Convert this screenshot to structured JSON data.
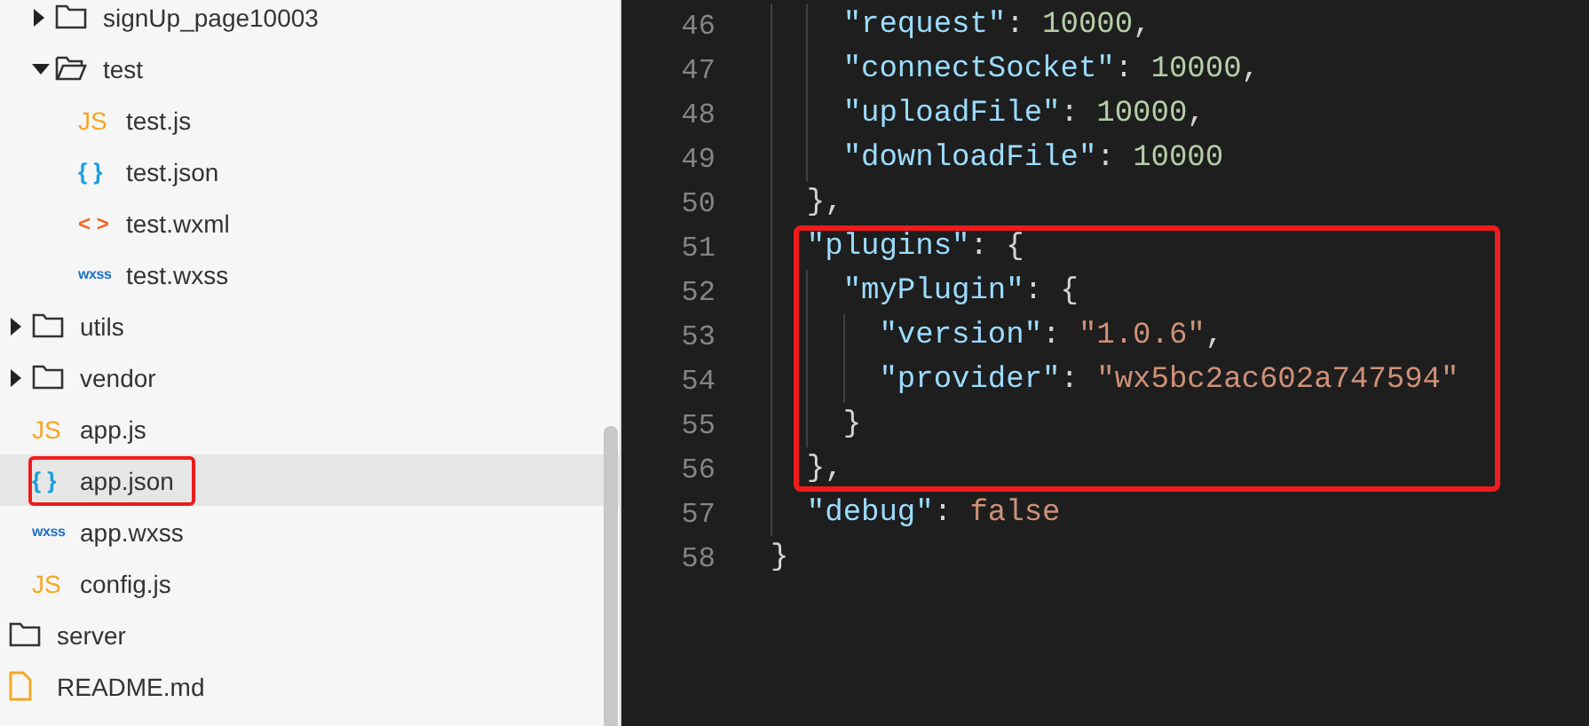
{
  "tree": [
    {
      "children": [
        {
          "children": [
            {
              "label": "signUp_page10003",
              "kind": "folder",
              "expanded": false,
              "selected": false,
              "boxed": false
            },
            {
              "label": "test",
              "kind": "folder",
              "expanded": true,
              "selected": false,
              "boxed": false,
              "children": [
                {
                  "label": "test.js",
                  "kind": "js",
                  "badge": "JS",
                  "selected": false,
                  "boxed": false
                },
                {
                  "label": "test.json",
                  "kind": "json",
                  "badge": "{ }",
                  "selected": false,
                  "boxed": false
                },
                {
                  "label": "test.wxml",
                  "kind": "wxml",
                  "badge": "< >",
                  "selected": false,
                  "boxed": false
                },
                {
                  "label": "test.wxss",
                  "kind": "wxss",
                  "badge": "wxss",
                  "selected": false,
                  "boxed": false
                }
              ]
            }
          ]
        },
        {
          "label": "utils",
          "kind": "folder",
          "expanded": false,
          "selected": false,
          "boxed": false
        },
        {
          "label": "vendor",
          "kind": "folder",
          "expanded": false,
          "selected": false,
          "boxed": false
        },
        {
          "label": "app.js",
          "kind": "js",
          "badge": "JS",
          "selected": false,
          "boxed": false
        },
        {
          "label": "app.json",
          "kind": "json",
          "badge": "{ }",
          "selected": true,
          "boxed": true
        },
        {
          "label": "app.wxss",
          "kind": "wxss",
          "badge": "wxss",
          "selected": false,
          "boxed": false
        },
        {
          "label": "config.js",
          "kind": "js",
          "badge": "JS",
          "selected": false,
          "boxed": false
        }
      ]
    },
    {
      "label": "server",
      "kind": "folder",
      "selected": false,
      "boxed": false
    },
    {
      "label": "README.md",
      "kind": "md",
      "selected": false,
      "boxed": false
    }
  ],
  "code": {
    "lines": [
      {
        "number": "46",
        "boxed": false,
        "tokens": [
          {
            "kind": "key",
            "text": "      \"request\""
          },
          {
            "kind": "punct",
            "text": ": "
          },
          {
            "kind": "num",
            "text": "10000"
          },
          {
            "kind": "punct",
            "text": ","
          }
        ]
      },
      {
        "number": "47",
        "boxed": false,
        "tokens": [
          {
            "kind": "key",
            "text": "      \"connectSocket\""
          },
          {
            "kind": "punct",
            "text": ": "
          },
          {
            "kind": "num",
            "text": "10000"
          },
          {
            "kind": "punct",
            "text": ","
          }
        ]
      },
      {
        "number": "48",
        "boxed": false,
        "tokens": [
          {
            "kind": "key",
            "text": "      \"uploadFile\""
          },
          {
            "kind": "punct",
            "text": ": "
          },
          {
            "kind": "num",
            "text": "10000"
          },
          {
            "kind": "punct",
            "text": ","
          }
        ]
      },
      {
        "number": "49",
        "boxed": false,
        "tokens": [
          {
            "kind": "key",
            "text": "      \"downloadFile\""
          },
          {
            "kind": "punct",
            "text": ": "
          },
          {
            "kind": "num",
            "text": "10000"
          }
        ]
      },
      {
        "number": "50",
        "boxed": false,
        "tokens": [
          {
            "kind": "punct",
            "text": "    },"
          }
        ]
      },
      {
        "number": "51",
        "boxed": true,
        "tokens": [
          {
            "kind": "key",
            "text": "    \"plugins\""
          },
          {
            "kind": "punct",
            "text": ": {"
          }
        ]
      },
      {
        "number": "52",
        "boxed": true,
        "tokens": [
          {
            "kind": "key",
            "text": "      \"myPlugin\""
          },
          {
            "kind": "punct",
            "text": ": {"
          }
        ]
      },
      {
        "number": "53",
        "boxed": true,
        "tokens": [
          {
            "kind": "key",
            "text": "        \"version\""
          },
          {
            "kind": "punct",
            "text": ": "
          },
          {
            "kind": "str",
            "text": "\"1.0.6\""
          },
          {
            "kind": "punct",
            "text": ","
          }
        ]
      },
      {
        "number": "54",
        "boxed": true,
        "tokens": [
          {
            "kind": "key",
            "text": "        \"provider\""
          },
          {
            "kind": "punct",
            "text": ": "
          },
          {
            "kind": "str",
            "text": "\"wx5bc2ac602a747594\""
          }
        ]
      },
      {
        "number": "55",
        "boxed": true,
        "tokens": [
          {
            "kind": "punct",
            "text": "      }"
          }
        ]
      },
      {
        "number": "56",
        "boxed": true,
        "tokens": [
          {
            "kind": "punct",
            "text": "    },"
          }
        ]
      },
      {
        "number": "57",
        "boxed": false,
        "tokens": [
          {
            "kind": "key",
            "text": "    \"debug\""
          },
          {
            "kind": "punct",
            "text": ": "
          },
          {
            "kind": "bool",
            "text": "false"
          }
        ]
      },
      {
        "number": "58",
        "boxed": false,
        "tokens": [
          {
            "kind": "punct",
            "text": "  }"
          }
        ]
      }
    ]
  }
}
